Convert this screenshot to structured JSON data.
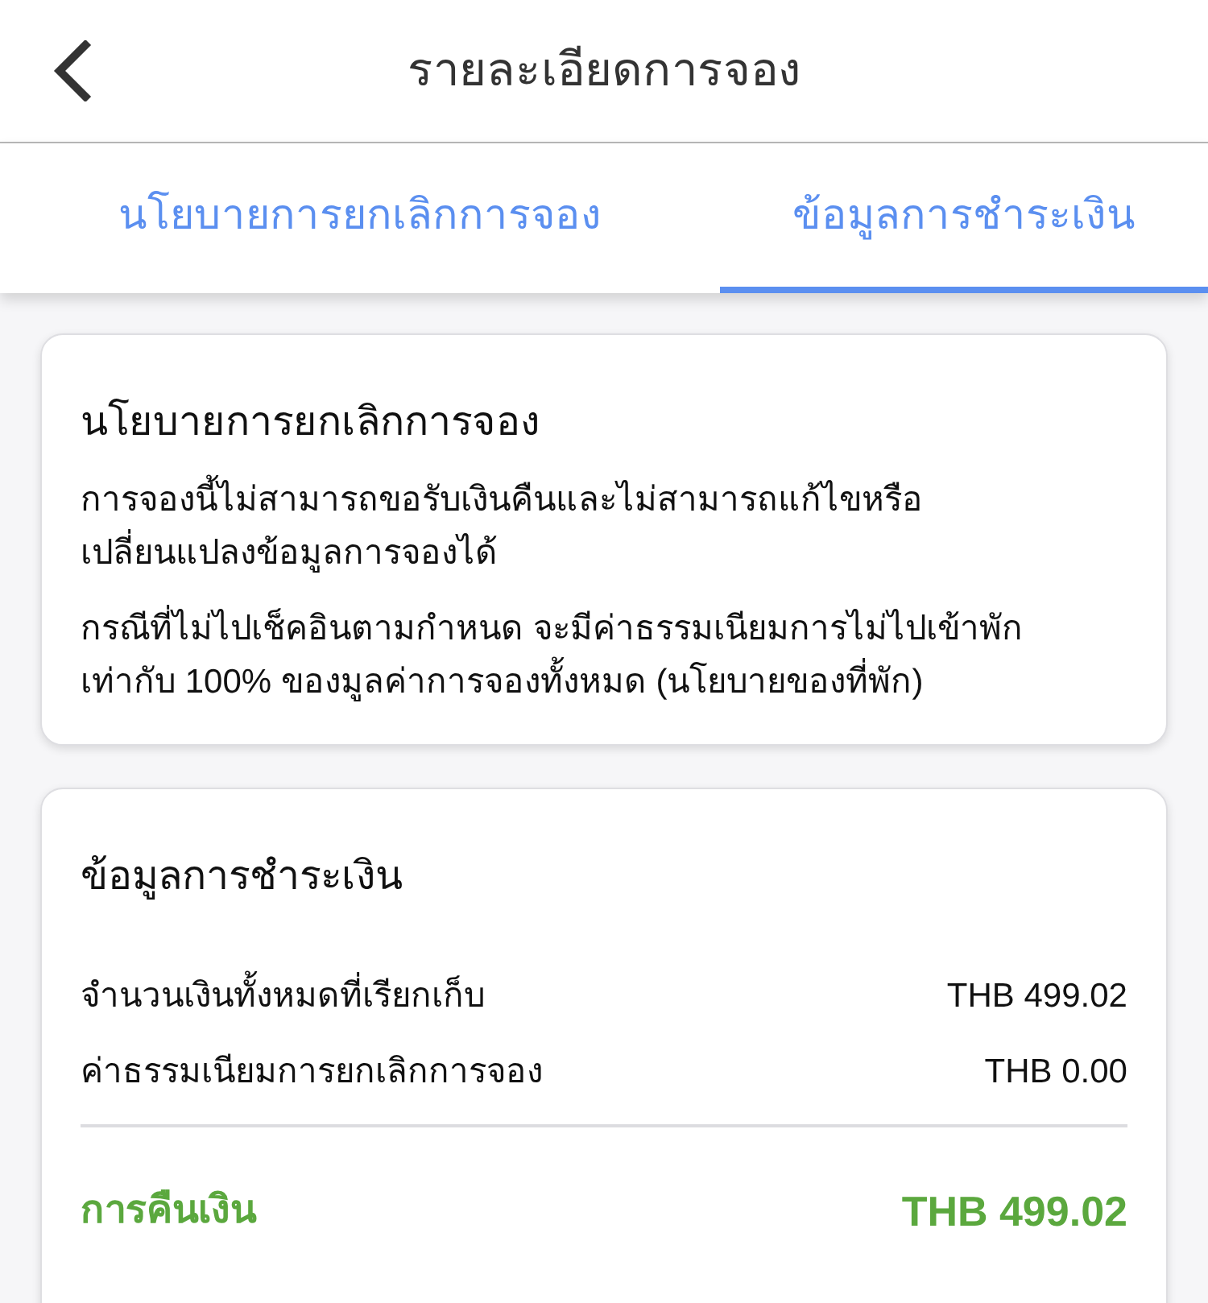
{
  "header": {
    "title": "รายละเอียดการจอง"
  },
  "tabs": [
    {
      "label": "นโยบายการยกเลิกการจอง",
      "selected": false
    },
    {
      "label": "ข้อมูลการชำระเงิน",
      "selected": true
    }
  ],
  "cancellation_policy": {
    "title": "นโยบายการยกเลิกการจอง",
    "paragraphs": [
      "การจองนี้ไม่สามารถขอรับเงินคืนและไม่สามารถแก้ไขหรือเปลี่ยนแปลงข้อมูลการจองได้",
      "กรณีที่ไม่ไปเช็คอินตามกำหนด จะมีค่าธรรมเนียมการไม่ไปเข้าพักเท่ากับ 100% ของมูลค่าการจองทั้งหมด (นโยบายของที่พัก)"
    ]
  },
  "payment_info": {
    "title": "ข้อมูลการชำระเงิน",
    "rows": [
      {
        "label": "จำนวนเงินทั้งหมดที่เรียกเก็บ",
        "value": "THB 499.02"
      },
      {
        "label": "ค่าธรรมเนียมการยกเลิกการจอง",
        "value": "THB 0.00"
      }
    ],
    "refund": {
      "label": "การคืนเงิน",
      "value": "THB 499.02"
    }
  }
}
